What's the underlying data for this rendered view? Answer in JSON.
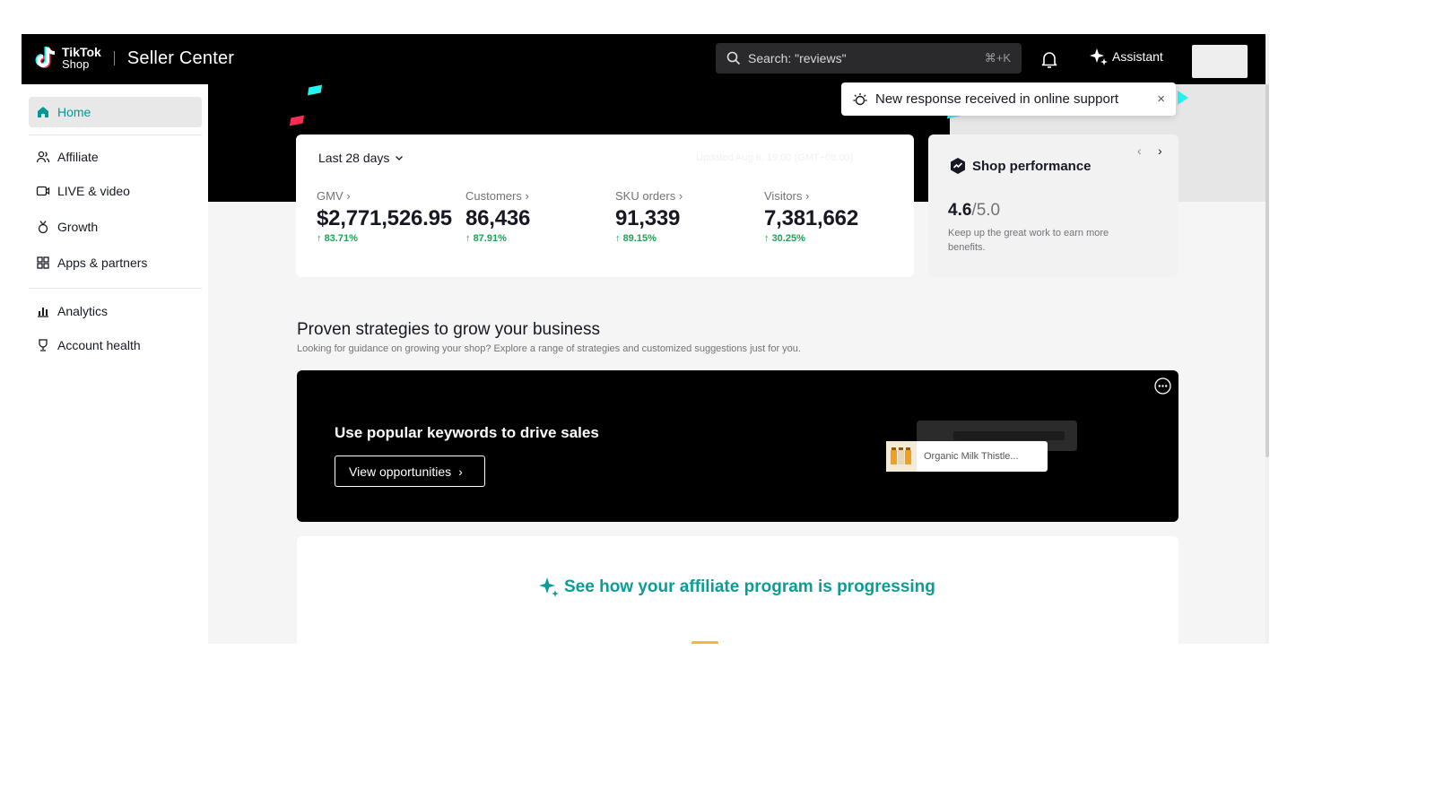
{
  "header": {
    "logo_line1": "TikTok",
    "logo_line2": "Shop",
    "title": "Seller Center",
    "search_text": "Search: \"reviews\"",
    "search_shortcut": "⌘+K",
    "assistant_label": "Assistant",
    "icons": [
      "tiktok-logo",
      "search-icon",
      "bell-icon",
      "sparkle-icon"
    ]
  },
  "sidebar": {
    "items": [
      {
        "label": "Home",
        "icon": "home-icon",
        "active": true
      },
      {
        "label": "Affiliate",
        "icon": "people-icon"
      },
      {
        "label": "LIVE & video",
        "icon": "video-icon"
      },
      {
        "label": "Growth",
        "icon": "medal-icon"
      },
      {
        "label": "Apps & partners",
        "icon": "apps-icon"
      },
      {
        "label": "Analytics",
        "icon": "chart-icon"
      },
      {
        "label": "Account health",
        "icon": "trophy-icon"
      }
    ]
  },
  "toast": {
    "message": "New response received in online support",
    "close": "×"
  },
  "metrics": {
    "range_label": "Last 28 days",
    "updated": "Updated Aug 6, 19:00 (GMT+08:00)",
    "items": [
      {
        "label": "GMV",
        "value": "$2,771,526.95",
        "change": "83.71%"
      },
      {
        "label": "Customers",
        "value": "86,436",
        "change": "87.91%"
      },
      {
        "label": "SKU orders",
        "value": "91,339",
        "change": "89.15%"
      },
      {
        "label": "Visitors",
        "value": "7,381,662",
        "change": "30.25%"
      }
    ]
  },
  "performance": {
    "title": "Shop performance",
    "score": "4.6",
    "out_of": "/5.0",
    "description": "Keep up the great work to earn more benefits."
  },
  "strategies": {
    "title": "Proven strategies to grow your business",
    "subtitle": "Looking for guidance on growing your shop? Explore a range of strategies and customized suggestions just for you.",
    "banner_heading": "Use popular keywords to drive sales",
    "banner_button": "View opportunities",
    "product_name": "Organic Milk Thistle..."
  },
  "affiliate": {
    "heading": "See how your affiliate program is progressing"
  },
  "colors": {
    "accent": "#009995",
    "positive": "#1ba555",
    "affiliate_heading": "#0a9d98",
    "confetti_cyan": "#25f4ee",
    "confetti_red": "#fe2c55"
  }
}
